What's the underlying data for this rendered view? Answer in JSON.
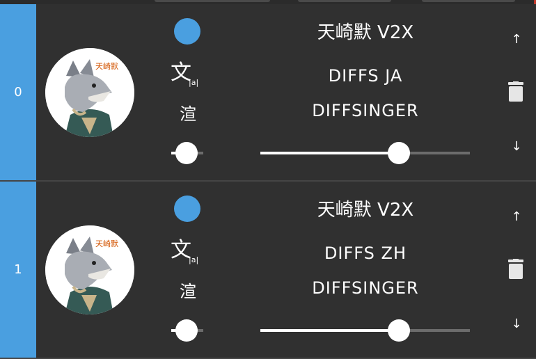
{
  "tracks": [
    {
      "index": "0",
      "singer": "天崎默 V2X",
      "phonemizer": "DIFFS JA",
      "renderer": "DIFFSINGER",
      "phonemizer_glyph": "文",
      "phonemizer_sub": "|a|",
      "renderer_glyph": "渲",
      "color": "#4a9fe0",
      "pan": 0.5,
      "volume": 0.66,
      "icons": {
        "move_up": "↑",
        "move_down": "↓",
        "remove": "trash-icon"
      }
    },
    {
      "index": "1",
      "singer": "天崎默 V2X",
      "phonemizer": "DIFFS ZH",
      "renderer": "DIFFSINGER",
      "phonemizer_glyph": "文",
      "phonemizer_sub": "|a|",
      "renderer_glyph": "渲",
      "color": "#4a9fe0",
      "pan": 0.5,
      "volume": 0.66,
      "icons": {
        "move_up": "↑",
        "move_down": "↓",
        "remove": "trash-icon"
      }
    }
  ]
}
